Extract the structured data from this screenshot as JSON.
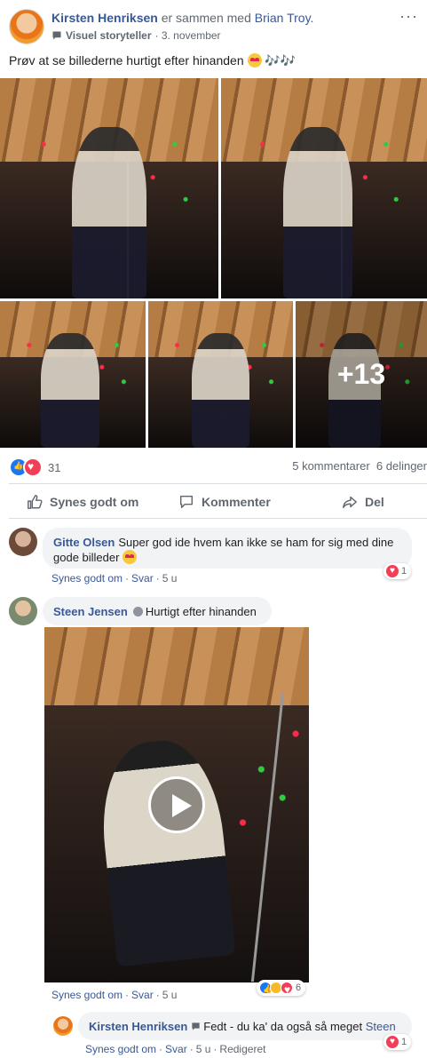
{
  "header": {
    "author": "Kirsten Henriksen",
    "with_text": "er sammen med",
    "tagged": "Brian Troy.",
    "role": "Visuel storyteller",
    "date": "· 3. november",
    "more": "···"
  },
  "post": {
    "text": "Prøv at se billederne hurtigt efter hinanden",
    "notes": "🎶🎶"
  },
  "photos": {
    "more_label": "+13"
  },
  "reactions": {
    "count": "31",
    "comments": "5 kommentarer",
    "shares": "6 delinger"
  },
  "actions": {
    "like": "Synes godt om",
    "comment": "Kommenter",
    "share": "Del"
  },
  "comments": [
    {
      "name": "Gitte Olsen",
      "text": "Super god ide hvem kan ikke se ham for sig med dine gode billeder",
      "like": "Synes godt om",
      "reply": "Svar",
      "time": "5 u",
      "reaction_count": "1"
    },
    {
      "name": "Steen Jensen",
      "text": "Hurtigt efter hinanden",
      "like": "Synes godt om",
      "reply": "Svar",
      "time": "5 u",
      "reaction_count": "6"
    },
    {
      "name": "Kirsten Henriksen",
      "text": "Fedt - du ka' da også så meget",
      "mention": "Steen",
      "like": "Synes godt om",
      "reply": "Svar",
      "time": "5 u",
      "edited": "Redigeret",
      "reaction_count": "1"
    }
  ],
  "colors": {
    "link": "#385898",
    "meta": "#606770",
    "like_blue": "#1877f2",
    "love_red": "#f33e58"
  }
}
